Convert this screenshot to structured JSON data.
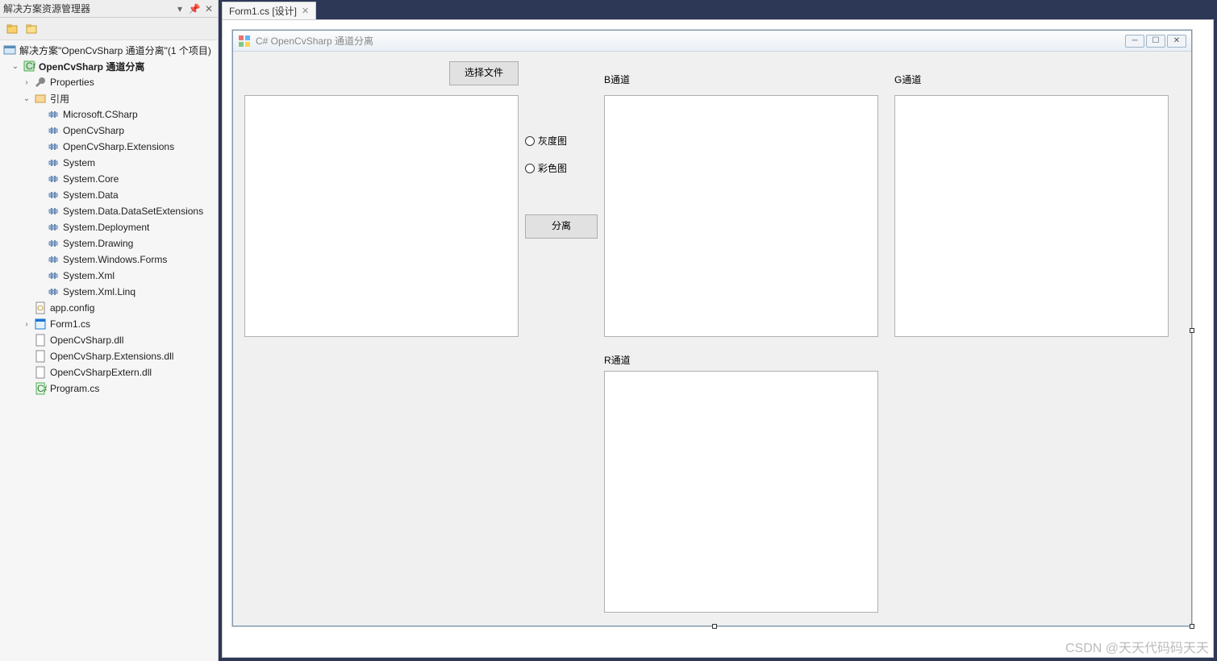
{
  "solutionExplorer": {
    "title": "解决方案资源管理器",
    "solutionText": "解决方案\"OpenCvSharp 通道分离\"(1 个项目)",
    "projectName": "OpenCvSharp 通道分离",
    "properties": "Properties",
    "references": "引用",
    "refs": [
      "Microsoft.CSharp",
      "OpenCvSharp",
      "OpenCvSharp.Extensions",
      "System",
      "System.Core",
      "System.Data",
      "System.Data.DataSetExtensions",
      "System.Deployment",
      "System.Drawing",
      "System.Windows.Forms",
      "System.Xml",
      "System.Xml.Linq"
    ],
    "files": {
      "appConfig": "app.config",
      "form1": "Form1.cs",
      "dll1": "OpenCvSharp.dll",
      "dll2": "OpenCvSharp.Extensions.dll",
      "dll3": "OpenCvSharpExtern.dll",
      "program": "Program.cs"
    }
  },
  "tab": {
    "label": "Form1.cs [设计]"
  },
  "winform": {
    "title": "C#  OpenCvSharp 通道分离",
    "selectFileBtn": "选择文件",
    "labelB": "B通道",
    "labelG": "G通道",
    "labelR": "R通道",
    "radioGray": "灰度图",
    "radioColor": "彩色图",
    "splitBtn": "分离"
  },
  "watermark": "CSDN @天天代码码天天"
}
